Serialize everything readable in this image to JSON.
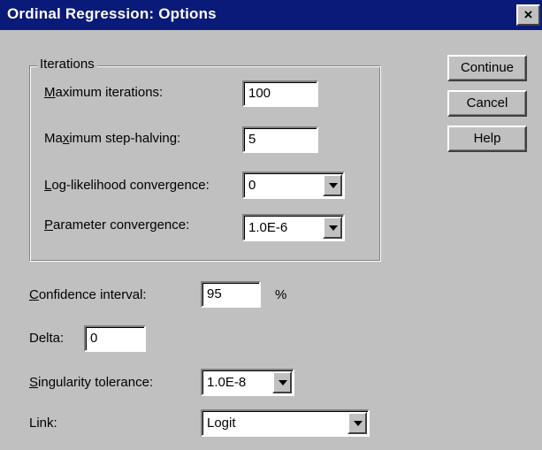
{
  "window": {
    "title": "Ordinal Regression: Options",
    "close_label": "×"
  },
  "iterations": {
    "group_label": "Iterations",
    "max_iterations": {
      "label_u": "M",
      "label_rest": "aximum iterations:",
      "value": "100"
    },
    "max_step_halving": {
      "label_pre": "Ma",
      "label_u": "x",
      "label_rest": "imum step-halving:",
      "value": "5"
    },
    "loglik_convergence": {
      "label_u": "L",
      "label_rest": "og-likelihood convergence:",
      "value": "0"
    },
    "param_convergence": {
      "label_u": "P",
      "label_rest": "arameter convergence:",
      "value": "1.0E-6"
    }
  },
  "confidence": {
    "label_u": "C",
    "label_rest": "onfidence interval:",
    "value": "95",
    "unit": "%"
  },
  "delta": {
    "label": "Delta:",
    "value": "0"
  },
  "singularity": {
    "label_u": "S",
    "label_rest": "ingularity tolerance:",
    "value": "1.0E-8"
  },
  "link": {
    "label": "Link:",
    "value": "Logit"
  },
  "buttons": {
    "continue": "Continue",
    "cancel": "Cancel",
    "help": "Help"
  }
}
